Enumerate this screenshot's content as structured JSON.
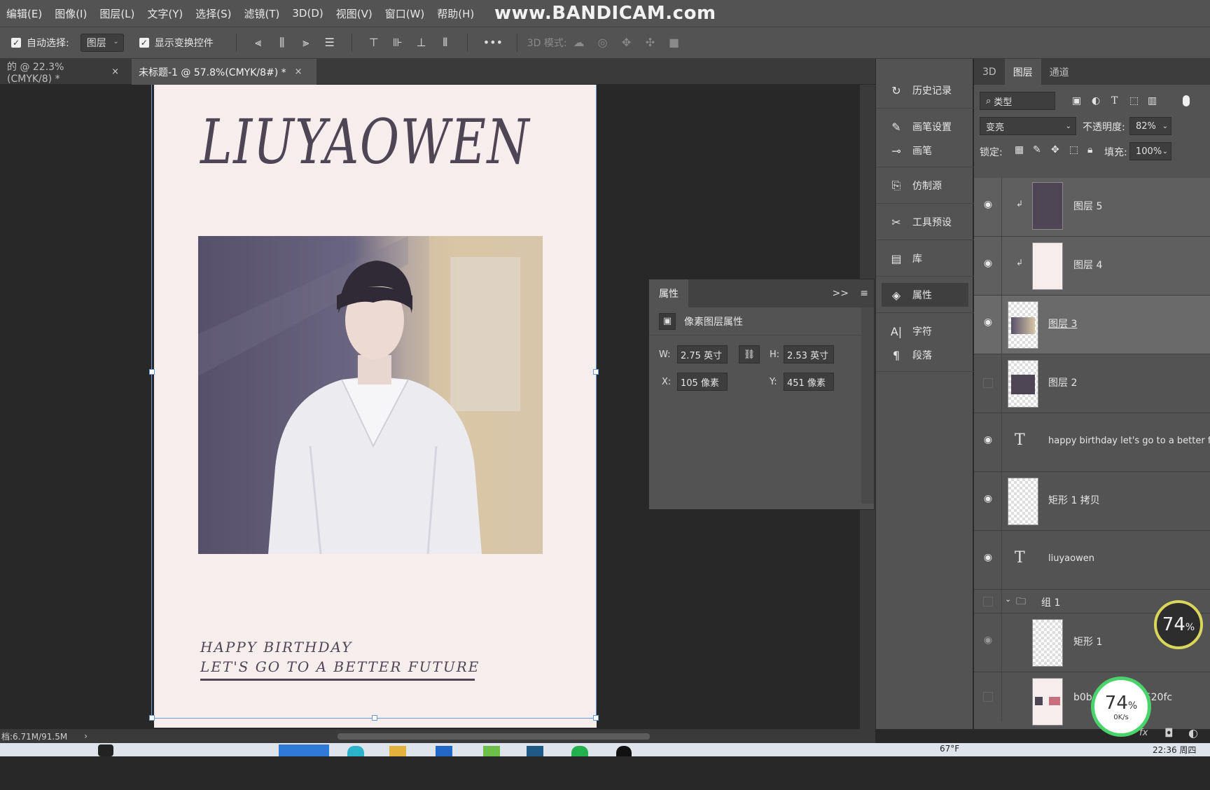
{
  "menu": [
    "编辑(E)",
    "图像(I)",
    "图层(L)",
    "文字(Y)",
    "选择(S)",
    "滤镜(T)",
    "3D(D)",
    "视图(V)",
    "窗口(W)",
    "帮助(H)"
  ],
  "watermark": "www.BANDICAM.com",
  "options": {
    "auto_select_label": "自动选择:",
    "auto_select_value": "图层",
    "show_transform_label": "显示变换控件",
    "more": "•••",
    "mode_3d_label": "3D 模式:"
  },
  "tabs": [
    {
      "label": "的 @ 22.3%(CMYK/8) *",
      "close": "×"
    },
    {
      "label": "未标题-1 @ 57.8%(CMYK/8#) *",
      "close": "×"
    }
  ],
  "document": {
    "title": "LIUYAOWEN",
    "caption_line1": "HAPPY BIRTHDAY",
    "caption_line2": "LET'S GO TO A BETTER FUTURE"
  },
  "status": {
    "doc_size": "档:6.71M/91.5M",
    "arrow": "›"
  },
  "properties": {
    "tab": "属性",
    "expand": ">>",
    "subtitle": "像素图层属性",
    "w_label": "W:",
    "w_value": "2.75 英寸",
    "h_label": "H:",
    "h_value": "2.53 英寸",
    "x_label": "X:",
    "x_value": "105 像素",
    "y_label": "Y:",
    "y_value": "451 像素"
  },
  "side_panels": [
    {
      "label": "历史记录",
      "icon": "history-icon"
    },
    {
      "label": "画笔设置",
      "icon": "brush-settings-icon"
    },
    {
      "label": "画笔",
      "icon": "brush-icon"
    },
    {
      "label": "仿制源",
      "icon": "clone-source-icon"
    },
    {
      "label": "工具预设",
      "icon": "tool-presets-icon"
    },
    {
      "label": "库",
      "icon": "library-icon"
    },
    {
      "label": "属性",
      "icon": "properties-icon"
    },
    {
      "label": "字符",
      "icon": "character-icon"
    },
    {
      "label": "段落",
      "icon": "paragraph-icon"
    }
  ],
  "layers_panel": {
    "tabs": [
      "3D",
      "图层",
      "通道"
    ],
    "active_tab": "图层",
    "filter_kind": "类型",
    "blend_mode": "变亮",
    "opacity_label": "不透明度:",
    "opacity_value": "82%",
    "lock_label": "锁定:",
    "fill_label": "填充:",
    "fill_value": "100%",
    "layers": [
      {
        "name": "图层 5",
        "visible": true
      },
      {
        "name": "图层 4",
        "visible": true
      },
      {
        "name": "图层 3",
        "visible": true
      },
      {
        "name": "图层 2",
        "visible": false
      },
      {
        "name": "happy birthday let's go to a better fu",
        "visible": true
      },
      {
        "name": "矩形 1 拷贝",
        "visible": true
      },
      {
        "name": "liuyaowen",
        "visible": true
      },
      {
        "name": "组 1",
        "visible": false
      },
      {
        "name": "矩形 1",
        "visible": true
      },
      {
        "name": "b0b4...1a268a520fc",
        "visible": false
      }
    ]
  },
  "overlay": {
    "gauge1_value": "74",
    "gauge1_unit": "%",
    "gauge2_value": "74",
    "gauge2_unit": "%",
    "gauge2_speed": "0K/s"
  },
  "taskbar": {
    "temperature": "67°F",
    "time": "22:36 周四"
  },
  "colors": {
    "accent": "#6d9ad2",
    "doc_bg": "#f6eeed",
    "doc_text": "#4f4655",
    "gauge_ring": "#d9d65a",
    "gauge_ring2": "#4ad36b"
  }
}
